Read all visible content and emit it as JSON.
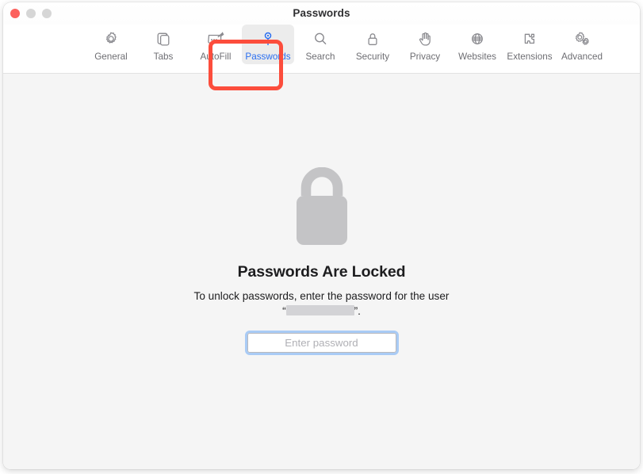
{
  "window": {
    "title": "Passwords",
    "traffic_lights": [
      {
        "name": "close",
        "color": "#fc615d"
      },
      {
        "name": "minimize",
        "color": "#d6d6d6"
      },
      {
        "name": "maximize",
        "color": "#d6d6d6"
      }
    ]
  },
  "toolbar": {
    "items": [
      {
        "label": "General",
        "icon": "gear-icon",
        "selected": false
      },
      {
        "label": "Tabs",
        "icon": "tabs-icon",
        "selected": false
      },
      {
        "label": "AutoFill",
        "icon": "autofill-icon",
        "selected": false
      },
      {
        "label": "Passwords",
        "icon": "key-icon",
        "selected": true
      },
      {
        "label": "Search",
        "icon": "magnifier-icon",
        "selected": false
      },
      {
        "label": "Security",
        "icon": "padlock-icon",
        "selected": false
      },
      {
        "label": "Privacy",
        "icon": "hand-icon",
        "selected": false
      },
      {
        "label": "Websites",
        "icon": "globe-icon",
        "selected": false
      },
      {
        "label": "Extensions",
        "icon": "puzzle-icon",
        "selected": false
      },
      {
        "label": "Advanced",
        "icon": "double-gear-icon",
        "selected": false
      }
    ],
    "selected_label_color": "#2a6ef0",
    "label_color": "#6e6e73"
  },
  "annotation": {
    "target": "Passwords",
    "color": "#fc4d3c"
  },
  "main": {
    "lock_icon": "locked-padlock-icon",
    "lock_color": "#c4c4c6",
    "heading": "Passwords Are Locked",
    "subtext_line1": "To unlock passwords, enter the password for",
    "subtext_prefix": "the user “",
    "subtext_suffix": "”.",
    "username_redacted": true,
    "password_input": {
      "value": "",
      "placeholder": "Enter password",
      "focused": true,
      "focus_ring_color": "#a9cbf5"
    }
  }
}
